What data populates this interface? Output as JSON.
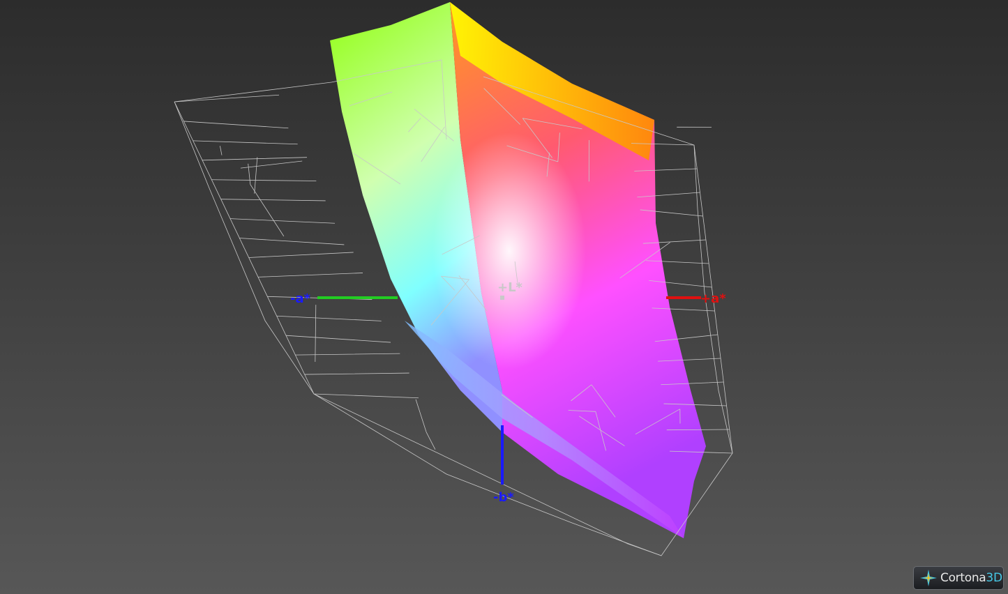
{
  "viewer": {
    "background": [
      "#2c2c2c",
      "#575757"
    ]
  },
  "axes": {
    "l_plus": {
      "label": "+L*",
      "color": "#c8c8c8"
    },
    "a_minus": {
      "label": "-a*",
      "color": "#1a1aff",
      "line_color": "#22cc22"
    },
    "a_plus": {
      "label": "+a*",
      "color": "#e01010",
      "line_color": "#e01010"
    },
    "b_minus": {
      "label": "-b*",
      "color": "#1a1aff",
      "line_color": "#1a1aff"
    }
  },
  "gamut": {
    "solid_colors": [
      "#ffff00",
      "#ff8c00",
      "#ff4070",
      "#ff40ff",
      "#b040ff",
      "#8080ff",
      "#80ffff",
      "#80ff20",
      "#ffffff"
    ],
    "wireframe_color": "#c8c8c8"
  },
  "logo": {
    "text_main": "Cortona",
    "text_accent": "3D",
    "icon": "cortona-star-icon"
  }
}
